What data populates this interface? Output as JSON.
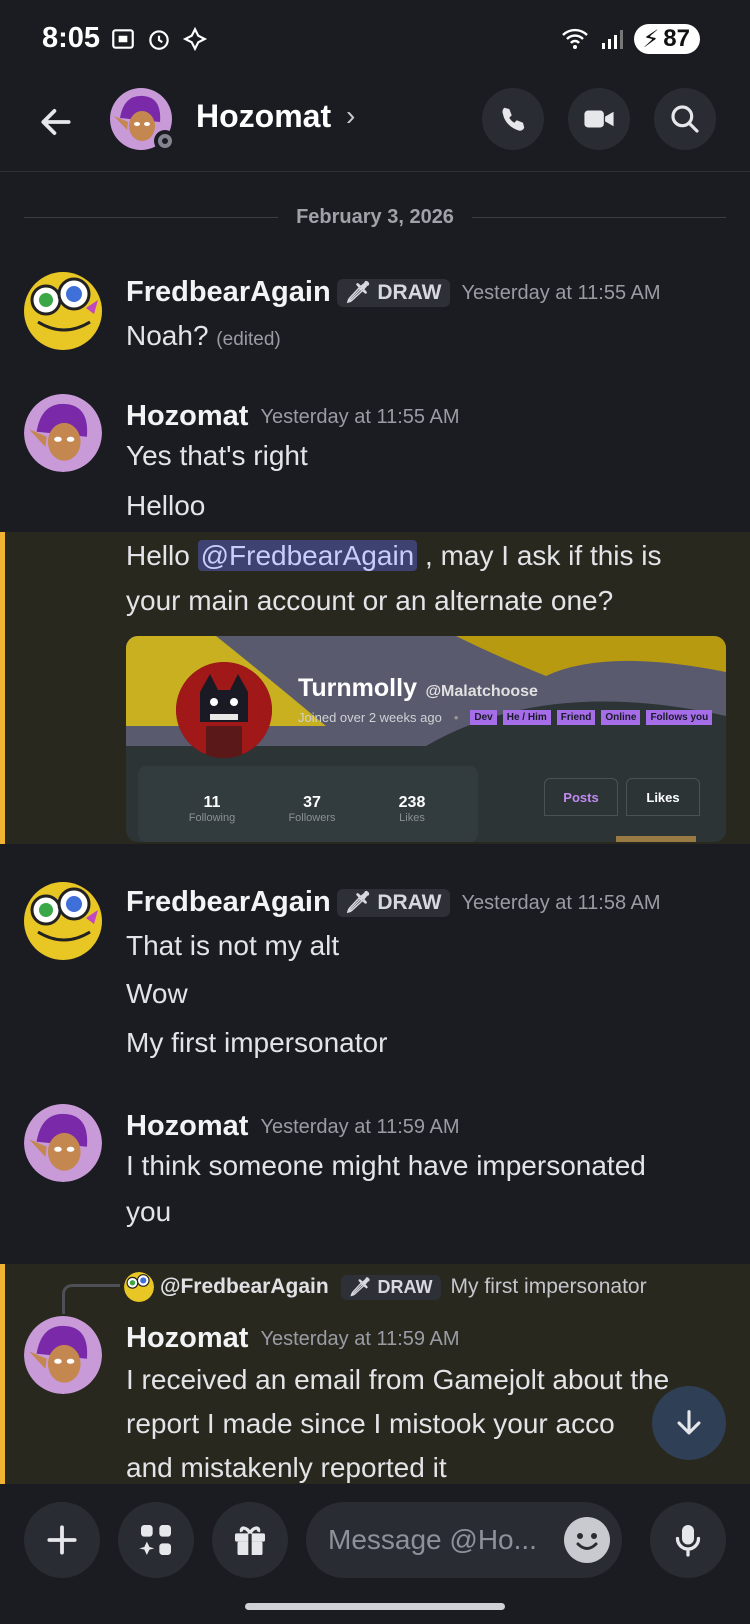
{
  "status_bar": {
    "time": "8:05",
    "battery": "87"
  },
  "header": {
    "title": "Hozomat"
  },
  "date_divider": "February 3, 2026",
  "messages": [
    {
      "author": "FredbearAgain",
      "tag": "DRAW",
      "timestamp": "Yesterday at 11:55 AM",
      "lines": [
        "Noah?"
      ],
      "edited": "(edited)"
    },
    {
      "author": "Hozomat",
      "timestamp": "Yesterday at 11:55 AM",
      "lines": [
        "Yes that's right",
        "Helloo"
      ],
      "highlight_pre": "Hello ",
      "mention": "@FredbearAgain",
      "highlight_post": " , may I ask if this is",
      "highlight_line2": "your main account or an alternate one?"
    },
    {
      "author": "FredbearAgain",
      "tag": "DRAW",
      "timestamp": "Yesterday at 11:58 AM",
      "lines": [
        "That is not my alt",
        "Wow",
        "My first impersonator"
      ]
    },
    {
      "author": "Hozomat",
      "timestamp": "Yesterday at 11:59 AM",
      "lines": [
        "I think someone might have impersonated",
        "you"
      ]
    },
    {
      "author": "Hozomat",
      "timestamp": "Yesterday at 11:59 AM",
      "lines": [
        "I received an email from Gamejolt about the",
        "report I made since I mistook your acco",
        "and mistakenly reported it"
      ]
    }
  ],
  "reply": {
    "name": "@FredbearAgain",
    "tag": "DRAW",
    "text": "My first impersonator"
  },
  "embed": {
    "name": "Turnmolly",
    "handle": "@Malatchoose",
    "joined": "Joined over 2 weeks ago",
    "badges": [
      "Dev",
      "He / Him",
      "Friend",
      "Online",
      "Follows you"
    ],
    "stats": [
      {
        "value": "11",
        "label": "Following"
      },
      {
        "value": "37",
        "label": "Followers"
      },
      {
        "value": "238",
        "label": "Likes"
      }
    ],
    "tabs": [
      "Posts",
      "Likes"
    ]
  },
  "composer": {
    "placeholder": "Message @Ho..."
  },
  "colors": {
    "accent_highlight": "#f0b232",
    "mention_bg": "#3d4270",
    "background": "#1b1c22"
  }
}
